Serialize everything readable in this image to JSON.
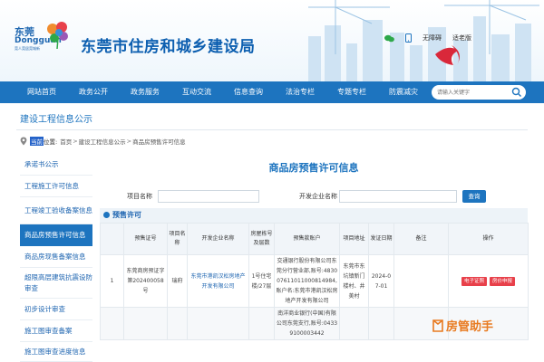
{
  "header": {
    "logo_title": "东莞",
    "logo_sub": "Dongguan",
    "logo_tag": "莞人莞居莞城新",
    "site_title": "东莞市住房和城乡建设局",
    "tools": {
      "accessibility": "无障碍",
      "elder_mode": "适老版"
    }
  },
  "nav": {
    "items": [
      "网站首页",
      "政务公开",
      "政务服务",
      "互动交流",
      "信息查询",
      "法治专栏",
      "专题专栏",
      "防震减灾"
    ],
    "search_placeholder": "请输入关键字"
  },
  "section": {
    "title": "建设工程信息公示",
    "breadcrumb_here": "当前",
    "breadcrumb_label": "位置:",
    "breadcrumb": [
      "首页",
      "建设工程信息公示",
      "商品房预售许可信息"
    ]
  },
  "sidebar": {
    "items": [
      {
        "label": "承诺书公示",
        "active": false
      },
      {
        "label": "工程施工许可信息",
        "active": false
      },
      {
        "label": "工程竣工验收备案信息",
        "active": false
      },
      {
        "label": "商品房预售许可信息",
        "active": true
      },
      {
        "label": "商品房现售备案信息",
        "active": false
      },
      {
        "label": "超限高层建筑抗震设防审查",
        "active": false
      },
      {
        "label": "初步设计审查",
        "active": false
      },
      {
        "label": "施工图审查备案",
        "active": false
      },
      {
        "label": "施工图审查进度信息",
        "active": false
      }
    ]
  },
  "main": {
    "title": "商品房预售许可信息",
    "filter": {
      "project_label": "项目名称",
      "developer_label": "开发企业名称",
      "query_button": "查询"
    },
    "subheading": "预售许可",
    "columns": [
      "",
      "预售证号",
      "项目名称",
      "开发企业名称",
      "房屋栋号及层数",
      "预售款账户",
      "项目地址",
      "发证日期",
      "备注",
      "操作"
    ],
    "rows": [
      {
        "index": "1",
        "cert_no": "东莞商房预证字第202400058号",
        "project": "瑞府",
        "developer": "东莞市港凯汉松房地产开发有限公司",
        "building": "1号住宅楼/27层",
        "account": "交通银行股份有限公司东莞分行营业部,账号:483007611011000814984,账户名:东莞市港凯汉松房地产开发有限公司",
        "address": "东莞市东坑镇新门楼村、井美村",
        "date": "2024-07-01",
        "remark": "",
        "actions": [
          "电子证照",
          "房价申报"
        ]
      },
      {
        "index": "",
        "cert_no": "",
        "project": "",
        "developer": "",
        "building": "",
        "account": "南洋商业银行(中国)有限公司东莞支行,账号:04339100003442",
        "address": "",
        "date": "",
        "remark": "",
        "actions": []
      }
    ]
  },
  "watermark": "房管助手",
  "colors": {
    "brand_blue": "#1d74bf",
    "title_blue": "#0d5fb0",
    "action_red": "#e8404a",
    "watermark_orange": "#e87a20"
  }
}
